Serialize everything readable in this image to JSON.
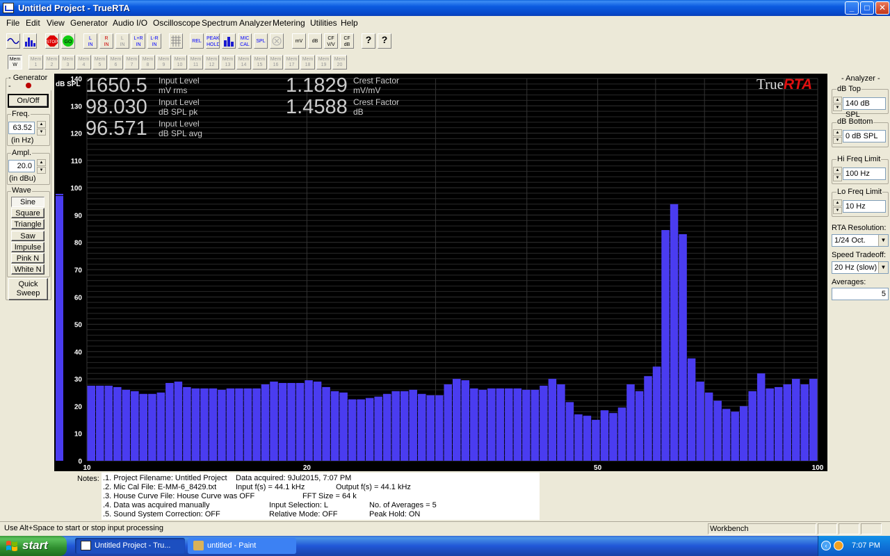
{
  "window": {
    "title": "Untitled Project - TrueRTA"
  },
  "menu": [
    "File",
    "Edit",
    "View",
    "Generator",
    "Audio I/O",
    "Oscilloscope",
    "Spectrum Analyzer",
    "Metering",
    "Utilities",
    "Help"
  ],
  "toolbar": {
    "in_buttons": [
      {
        "top": "L",
        "bottom": "IN"
      },
      {
        "top": "R",
        "bottom": "IN"
      },
      {
        "top": "L",
        "bottom": "IN"
      },
      {
        "top": "L+R",
        "bottom": "IN"
      },
      {
        "top": "L-R",
        "bottom": "IN"
      }
    ],
    "rel": "REL",
    "peak_hold": "PEAK HOLD",
    "mic_cal": "MIC CAL",
    "spl": "SPL",
    "mv": "mV",
    "db": "dB",
    "cf_vv": "CF V/V",
    "cf_db": "CF dB",
    "help": "?",
    "context_help": "?"
  },
  "mem_bar": {
    "active": {
      "top": "Mem",
      "bottom": "W"
    },
    "items": [
      "1",
      "2",
      "3",
      "4",
      "5",
      "6",
      "7",
      "8",
      "9",
      "10",
      "11",
      "12",
      "13",
      "14",
      "15",
      "16",
      "17",
      "18",
      "19",
      "20"
    ],
    "prefix": "Mem"
  },
  "generator": {
    "title": "Generator",
    "on_off": "On/Off",
    "freq_label": "Freq.",
    "freq_value": "63.52",
    "freq_unit": "(in Hz)",
    "ampl_label": "Ampl.",
    "ampl_value": "20.0",
    "ampl_unit": "(in dBu)",
    "wave_label": "Wave",
    "waves": [
      "Sine",
      "Square",
      "Triangle",
      "Saw",
      "Impulse",
      "Pink N",
      "White N"
    ],
    "quick_sweep": [
      "Quick",
      "Sweep"
    ]
  },
  "readouts": {
    "input_rms": {
      "value": "1650.5",
      "label1": "Input Level",
      "label2": "mV rms"
    },
    "input_pk": {
      "value": "98.030",
      "label1": "Input Level",
      "label2": "dB SPL pk"
    },
    "input_avg": {
      "value": "96.571",
      "label1": "Input Level",
      "label2": "dB SPL avg"
    },
    "crest_vv": {
      "value": "1.1829",
      "label1": "Crest Factor",
      "label2": "mV/mV"
    },
    "crest_db": {
      "value": "1.4588",
      "label1": "Crest Factor",
      "label2": "dB"
    }
  },
  "brand": {
    "part1": "True",
    "part2": "RTA"
  },
  "chart_data": {
    "type": "bar",
    "ylabel": "dB SPL",
    "ylim": [
      0,
      140
    ],
    "yticks": [
      0,
      10,
      20,
      30,
      40,
      50,
      60,
      70,
      80,
      90,
      100,
      110,
      120,
      130,
      140
    ],
    "xscale": "log",
    "xlim": [
      10,
      100
    ],
    "xtick_labels": [
      "10",
      "20",
      "50",
      "100"
    ],
    "grid": true,
    "colors": {
      "bars": "#4a3cf0",
      "background": "#000000",
      "grid": "#2a2a2a",
      "axis_text": "#ffffff"
    },
    "input_meter": 97,
    "values": [
      27.5,
      27.5,
      27.5,
      27,
      26,
      25.5,
      24.5,
      24.5,
      25,
      28.5,
      29,
      27,
      26.5,
      26.5,
      26.5,
      26,
      26.5,
      26.5,
      26.5,
      26.5,
      28,
      29,
      28.5,
      28.5,
      28.5,
      29.5,
      29,
      27,
      25.5,
      25,
      22.5,
      22.5,
      23,
      23.5,
      24.5,
      25.5,
      25.5,
      26,
      24.5,
      24,
      24,
      28,
      30,
      29.5,
      26.5,
      26,
      26.5,
      26.5,
      26.5,
      26.5,
      26,
      26,
      27.5,
      30,
      28,
      21.5,
      17,
      16.5,
      15,
      18.5,
      17.5,
      19.5,
      28,
      25.5,
      31,
      34.5,
      84.5,
      94,
      83,
      37.5,
      29,
      25,
      22,
      19,
      18,
      20,
      25.5,
      32,
      26.5,
      27,
      28,
      30,
      28,
      30
    ]
  },
  "analyzer": {
    "title": "Analyzer",
    "db_top_label": "dB Top",
    "db_top_value": "140 dB SPL",
    "db_bottom_label": "dB Bottom",
    "db_bottom_value": "0 dB SPL",
    "hi_freq_label": "Hi Freq Limit",
    "hi_freq_value": "100 Hz",
    "lo_freq_label": "Lo Freq Limit",
    "lo_freq_value": "10 Hz",
    "rta_res_label": "RTA Resolution:",
    "rta_res_value": "1/24 Oct.",
    "speed_label": "Speed Tradeoff:",
    "speed_value": "20 Hz (slow)",
    "averages_label": "Averages:",
    "averages_value": "5"
  },
  "notes": {
    "label": "Notes:",
    "l1a": ".1. Project Filename: Untitled Project",
    "l1b": "Data acquired: 9Jul2015, 7:07 PM",
    "l2a": ".2. Mic Cal File: E-MM-6_8429.txt",
    "l2b": "Input f(s) = 44.1 kHz",
    "l2c": "Output f(s) = 44.1 kHz",
    "l3a": ".3. House Curve File: House Curve was OFF",
    "l3b": "FFT Size = 64 k",
    "l4a": ".4. Data was acquired manually",
    "l4b": "Input Selection: L",
    "l4c": "No. of Averages = 5",
    "l5a": ".5. Sound System Correction: OFF",
    "l5b": "Relative Mode:  OFF",
    "l5c": "Peak Hold: ON"
  },
  "status": {
    "hint": "Use Alt+Space to start or stop input processing",
    "mode": "Workbench"
  },
  "taskbar": {
    "start": "start",
    "items": [
      "Untitled Project - Tru...",
      "untitled - Paint"
    ],
    "clock": "7:07 PM"
  }
}
